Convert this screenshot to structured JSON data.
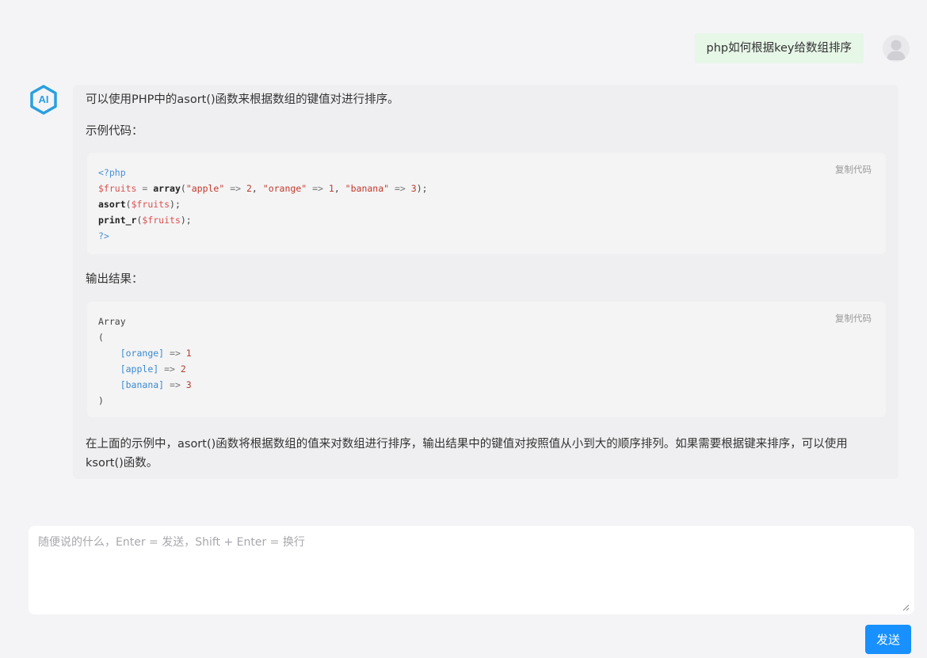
{
  "conversation": {
    "user_message": "php如何根据key给数组排序",
    "ai_logo_text": "AI",
    "ai_intro": "可以使用PHP中的asort()函数来根据数组的键值对进行排序。",
    "example_label": "示例代码：",
    "output_label": "输出结果：",
    "copy_label": "复制代码",
    "code_lines": {
      "l1": "<?php",
      "l2_var": "$fruits",
      "l2_eq": " = ",
      "l2_fn": "array",
      "l2_open": "(",
      "l2_s1": "\"apple\"",
      "l2_a1": " => ",
      "l2_n1": "2",
      "l2_c1": ", ",
      "l2_s2": "\"orange\"",
      "l2_a2": " => ",
      "l2_n2": "1",
      "l2_c2": ", ",
      "l2_s3": "\"banana\"",
      "l2_a3": " => ",
      "l2_n3": "3",
      "l2_close": ");",
      "l3_fn": "asort",
      "l3_open": "(",
      "l3_var": "$fruits",
      "l3_close": ");",
      "l4_fn": "print_r",
      "l4_open": "(",
      "l4_var": "$fruits",
      "l4_close": ");",
      "l5": "?>"
    },
    "output_lines": {
      "o1": "Array",
      "o2": "(",
      "o3_key": "[orange]",
      "o3_arrow": " => ",
      "o3_val": "1",
      "o4_key": "[apple]",
      "o4_arrow": " => ",
      "o4_val": "2",
      "o5_key": "[banana]",
      "o5_arrow": " => ",
      "o5_val": "3",
      "o6": ")"
    },
    "ai_conclusion": "在上面的示例中，asort()函数将根据数组的值来对数组进行排序，输出结果中的键值对按照值从小到大的顺序排列。如果需要根据键来排序，可以使用ksort()函数。"
  },
  "input": {
    "placeholder": "随便说的什么，Enter = 发送，Shift + Enter = 换行",
    "value": ""
  },
  "send_label": "发送",
  "colors": {
    "send_button": "#1890ff",
    "user_bubble": "#e6f6e7",
    "ai_logo": "#2a9fe0"
  }
}
